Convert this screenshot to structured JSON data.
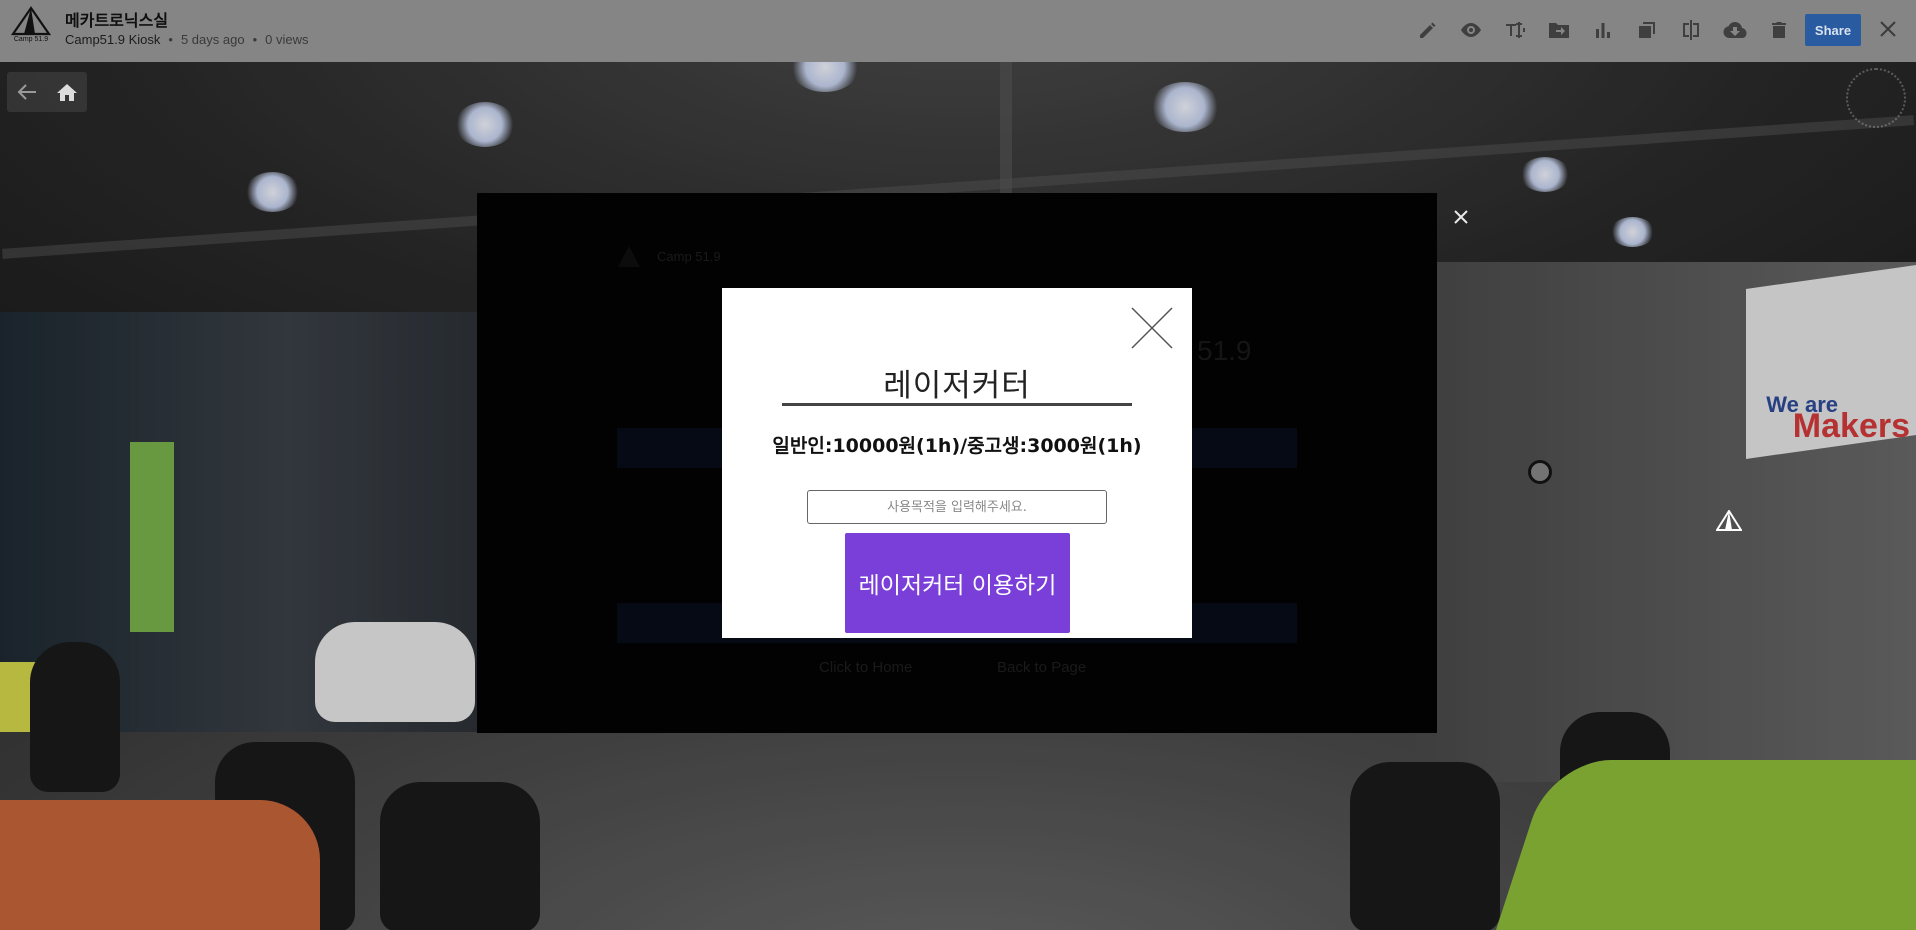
{
  "header": {
    "logo_text": "Camp 51.9",
    "title": "메카트로닉스실",
    "author": "Camp51.9 Kiosk",
    "age": "5 days ago",
    "views": "0 views",
    "share_label": "Share",
    "toolbar_icons": [
      "pencil-icon",
      "eye-icon",
      "text-edit-icon",
      "folder-move-icon",
      "bar-chart-icon",
      "copy-icon",
      "compare-icon",
      "cloud-download-icon",
      "trash-icon"
    ]
  },
  "nav": {
    "back_icon": "arrow-left-icon",
    "home_icon": "home-icon"
  },
  "background_modal": {
    "ghost_brand": "Camp 51.9",
    "ghost_logo_text": "51.9",
    "ghost_link_home": "Click to Home",
    "ghost_link_back": "Back to Page"
  },
  "dialog": {
    "title": "레이저커터",
    "price": "일반인:10000원(1h)/중고생:3000원(1h)",
    "purpose_placeholder": "사용목적을 입력해주세요.",
    "purpose_value": "",
    "button_label": "레이저커터 이용하기"
  },
  "scene": {
    "sign_we_are": "We are",
    "sign_makers": "Makers"
  },
  "colors": {
    "share_button": "#285ba0",
    "use_button": "#7a3fd9",
    "topbar": "#858585"
  }
}
